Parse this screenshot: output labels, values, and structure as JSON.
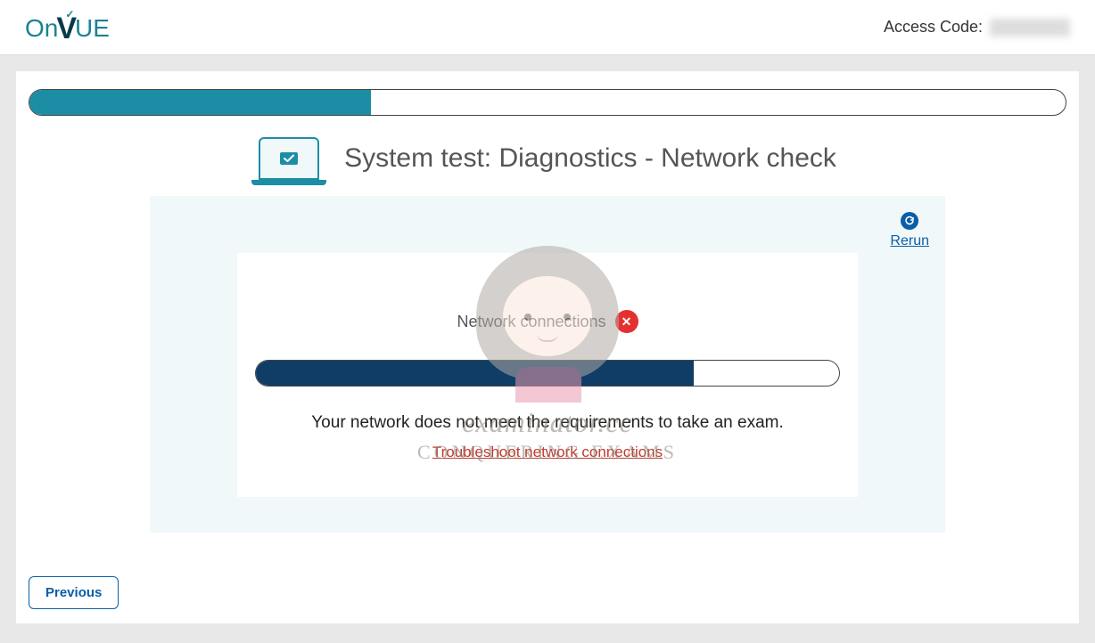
{
  "header": {
    "logo_on": "On",
    "logo_v": "V",
    "logo_ue": "UE",
    "access_code_label": "Access Code:"
  },
  "page": {
    "title": "System test: Diagnostics - Network check",
    "outer_progress_pct": 33,
    "rerun_label": "Rerun",
    "network_label": "Network connections",
    "inner_progress_pct": 75,
    "fail_message": "Your network does not meet the requirements to take an exam.",
    "troubleshoot_link": "Troubleshoot network connections",
    "previous_button": "Previous"
  },
  "watermark": {
    "line1": "examinator.cc",
    "line2": "CONQUERING EXAMS"
  }
}
